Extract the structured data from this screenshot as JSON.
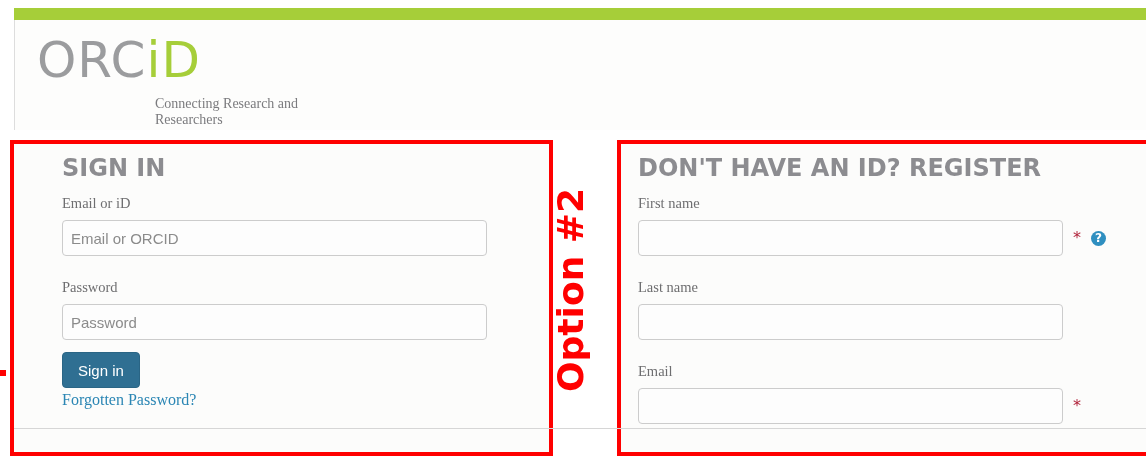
{
  "header": {
    "logo": {
      "grey_part": "ORC",
      "green_part": "iD"
    },
    "tagline": "Connecting Research and Researchers"
  },
  "sign_in": {
    "annotated": true,
    "heading": "SIGN IN",
    "fields": [
      {
        "label": "Email or iD",
        "placeholder": "Email or ORCID"
      },
      {
        "label": "Password",
        "placeholder": "Password"
      }
    ],
    "button": "Sign in",
    "link": "Forgotten Password?"
  },
  "register": {
    "annotated": true,
    "annotation_label": "Option #2",
    "heading": "DON'T HAVE AN ID? REGISTER",
    "fields": [
      {
        "label": "First name",
        "marker": "*",
        "help": "?"
      },
      {
        "label": "Last name"
      },
      {
        "label": "Email",
        "marker": "*"
      }
    ]
  }
}
